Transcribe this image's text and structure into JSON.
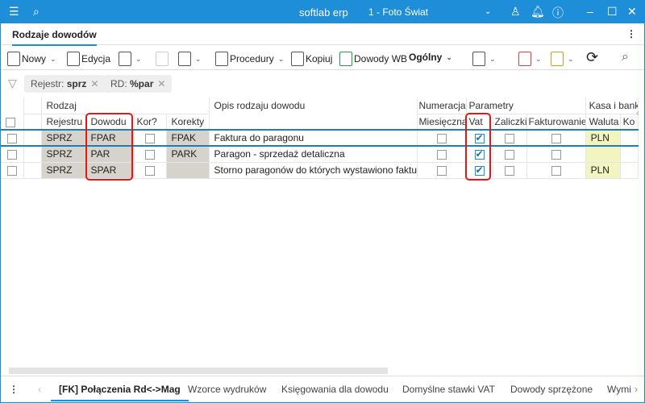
{
  "titlebar": {
    "app": "softlab erp",
    "company": "1 - Foto Świat"
  },
  "doc_tab": "Rodzaje dowodów",
  "toolbar": {
    "new": "Nowy",
    "edit": "Edycja",
    "procedures": "Procedury",
    "copy": "Kopiuj",
    "wb": "Dowody WB",
    "general": "Ogólny"
  },
  "filters": [
    {
      "key": "Rejestr:",
      "val": "sprz"
    },
    {
      "key": "RD:",
      "val": "%par"
    }
  ],
  "grid": {
    "groups": {
      "rodzaj": "Rodzaj",
      "opis": "Opis rodzaju dowodu",
      "numeracja": "Numeracja",
      "parametry": "Parametry",
      "kasa": "Kasa i bank"
    },
    "cols": {
      "rejestru": "Rejestru",
      "dowodu": "Dowodu",
      "kor": "Kor?",
      "korekty": "Korekty",
      "miesieczna": "Miesięczna",
      "vat": "Vat",
      "zaliczki": "Zaliczki",
      "fakturowanie": "Fakturowanie",
      "waluta": "Waluta",
      "ko": "Ko"
    },
    "rows": [
      {
        "rejestr": "SPRZ",
        "dowod": "FPAR",
        "kor": false,
        "korekty": "FPAK",
        "opis": "Faktura do paragonu",
        "miesieczna": false,
        "vat": true,
        "zaliczki": false,
        "fakturowanie": false,
        "waluta": "PLN"
      },
      {
        "rejestr": "SPRZ",
        "dowod": "PAR",
        "kor": false,
        "korekty": "PARK",
        "opis": "Paragon - sprzedaż detaliczna",
        "miesieczna": false,
        "vat": true,
        "zaliczki": false,
        "fakturowanie": false,
        "waluta": ""
      },
      {
        "rejestr": "SPRZ",
        "dowod": "SPAR",
        "kor": false,
        "korekty": "",
        "opis": "Storno paragonów do których wystawiono fakturę",
        "miesieczna": false,
        "vat": true,
        "zaliczki": false,
        "fakturowanie": false,
        "waluta": "PLN"
      }
    ]
  },
  "bottom_tabs": [
    "[FK] Połączenia Rd<->Mag",
    "Wzorce wydruków",
    "Księgowania dla dowodu",
    "Domyślne stawki VAT",
    "Dowody sprzężone",
    "Wymi"
  ]
}
